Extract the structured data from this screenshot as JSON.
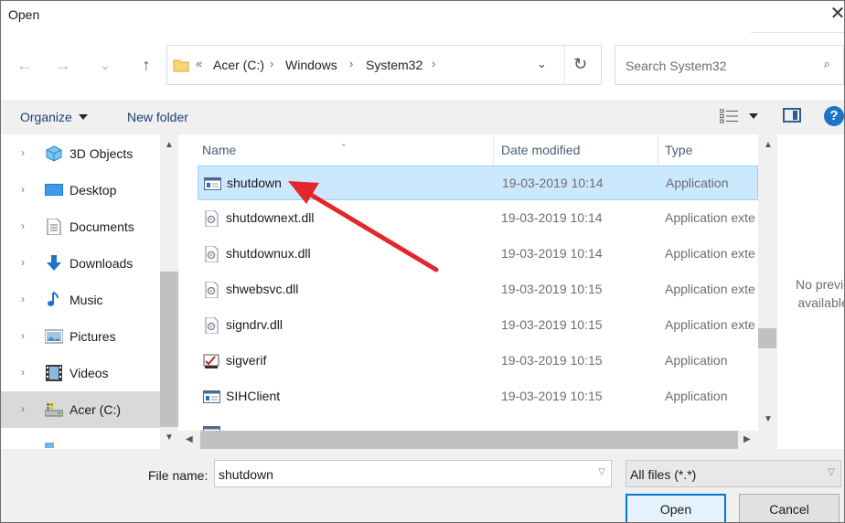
{
  "window": {
    "title": "Open",
    "close_glyph": "✕"
  },
  "address": {
    "back_glyph": "←",
    "forward_glyph": "→",
    "recent_glyph": "⌄",
    "up_glyph": "↑",
    "root_glyph": "«",
    "crumbs": [
      "Acer (C:)",
      "Windows",
      "System32"
    ],
    "sep_glyph": "›",
    "dropdown_glyph": "⌄",
    "refresh_glyph": "↻"
  },
  "search": {
    "placeholder": "Search System32",
    "icon_glyph": "⌕"
  },
  "toolbar": {
    "organize": "Organize",
    "new_folder": "New folder",
    "help": "?"
  },
  "sidebar": {
    "items": [
      {
        "label": "3D Objects",
        "icon": "3d-objects-icon",
        "chevron": "›"
      },
      {
        "label": "Desktop",
        "icon": "desktop-icon",
        "chevron": "›"
      },
      {
        "label": "Documents",
        "icon": "documents-icon",
        "chevron": "›"
      },
      {
        "label": "Downloads",
        "icon": "downloads-icon",
        "chevron": "›"
      },
      {
        "label": "Music",
        "icon": "music-icon",
        "chevron": "›"
      },
      {
        "label": "Pictures",
        "icon": "pictures-icon",
        "chevron": "›"
      },
      {
        "label": "Videos",
        "icon": "videos-icon",
        "chevron": "›"
      },
      {
        "label": "Acer (C:)",
        "icon": "drive-icon",
        "chevron": "›",
        "selected": true
      }
    ]
  },
  "columns": {
    "name": "Name",
    "date": "Date modified",
    "type": "Type"
  },
  "files": [
    {
      "name": "shutdown",
      "date": "19-03-2019 10:14",
      "type": "Application",
      "icon": "application-icon",
      "selected": true
    },
    {
      "name": "shutdownext.dll",
      "date": "19-03-2019 10:14",
      "type": "Application exte",
      "icon": "dll-file-icon"
    },
    {
      "name": "shutdownux.dll",
      "date": "19-03-2019 10:14",
      "type": "Application exte",
      "icon": "dll-file-icon"
    },
    {
      "name": "shwebsvc.dll",
      "date": "19-03-2019 10:15",
      "type": "Application exte",
      "icon": "dll-file-icon"
    },
    {
      "name": "signdrv.dll",
      "date": "19-03-2019 10:15",
      "type": "Application exte",
      "icon": "dll-file-icon"
    },
    {
      "name": "sigverif",
      "date": "19-03-2019 10:15",
      "type": "Application",
      "icon": "sigverif-app-icon"
    },
    {
      "name": "SIHClient",
      "date": "19-03-2019 10:15",
      "type": "Application",
      "icon": "application-icon"
    }
  ],
  "preview": {
    "text": "No previe available"
  },
  "bottom": {
    "filename_label": "File name:",
    "filename_value": "shutdown",
    "filetype_value": "All files (*.*)",
    "open_label": "Open",
    "cancel_label": "Cancel"
  },
  "colors": {
    "accent": "#0078d7",
    "selection": "#cce8ff",
    "annotation_arrow": "#e3262c"
  }
}
